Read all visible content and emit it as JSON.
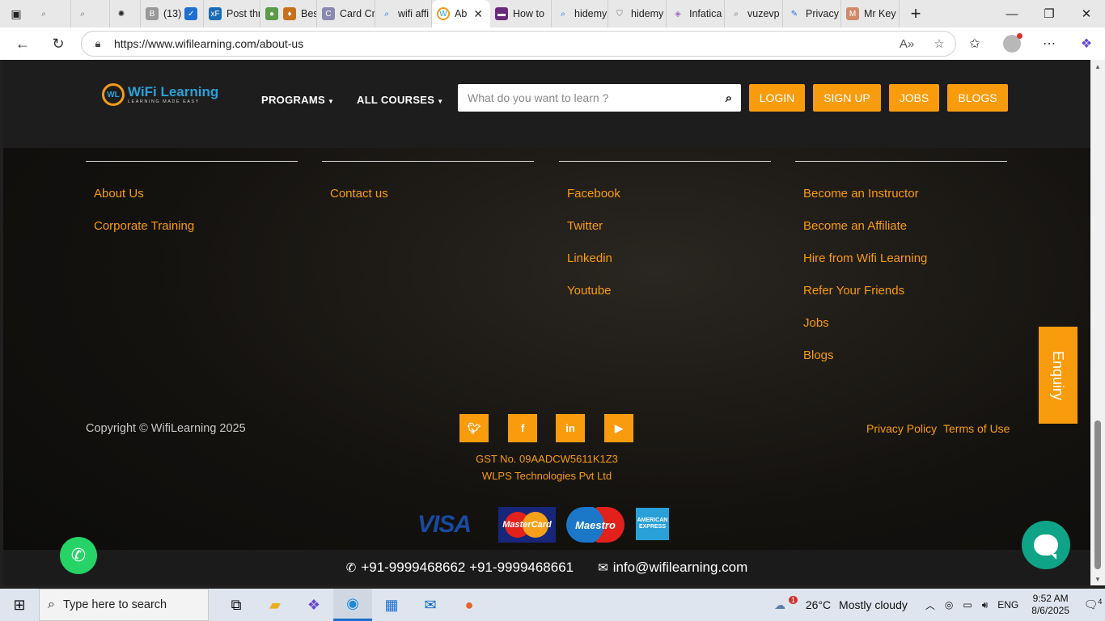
{
  "browser": {
    "tabs": [
      {
        "label": "",
        "icon": "magnifier-icon"
      },
      {
        "label": "",
        "icon": "magnifier-icon"
      },
      {
        "label": "",
        "icon": "chatgpt-icon"
      },
      {
        "label": "(13)",
        "icon": "bookmark-icon"
      },
      {
        "label": "Post thr",
        "icon": "xf-icon"
      },
      {
        "label": "Bes",
        "icon": "globe-icon"
      },
      {
        "label": "Card Cr",
        "icon": "card-icon"
      },
      {
        "label": "wifi affi",
        "icon": "magnifier-icon"
      },
      {
        "label": "Ab",
        "icon": "wifilearning-icon",
        "active": true
      },
      {
        "label": "How to",
        "icon": "site-icon"
      },
      {
        "label": "hidemy",
        "icon": "magnifier-icon"
      },
      {
        "label": "hidemy",
        "icon": "shield-icon"
      },
      {
        "label": "Infatica",
        "icon": "infatica-icon"
      },
      {
        "label": "vuzevp",
        "icon": "magnifier-icon"
      },
      {
        "label": "Privacy",
        "icon": "privacy-icon"
      },
      {
        "label": "Mr Key",
        "icon": "mrkey-icon"
      }
    ],
    "url": "https://www.wifilearning.com/about-us"
  },
  "header": {
    "logo_main": "WiFi Learning",
    "logo_tag": "LEARNING MADE EASY",
    "nav": {
      "programs": "PROGRAMS",
      "all_courses": "ALL COURSES"
    },
    "search_placeholder": "What do you want to learn ?",
    "buttons": {
      "login": "LOGIN",
      "signup": "SIGN UP",
      "jobs": "JOBS",
      "blogs": "BLOGS"
    }
  },
  "footer": {
    "col1": [
      "About Us",
      "Corporate Training"
    ],
    "col2": [
      "Contact us"
    ],
    "col3": [
      "Facebook",
      "Twitter",
      "Linkedin",
      "Youtube"
    ],
    "col4": [
      "Become an Instructor",
      "Become an Affiliate",
      "Hire from Wifi Learning",
      "Refer Your Friends",
      "Jobs",
      "Blogs"
    ],
    "copyright": "Copyright © WifiLearning 2025",
    "privacy": "Privacy Policy",
    "terms": "Terms of Use",
    "gst": "GST No. 09AADCW5611K1Z3",
    "company": "WLPS Technologies Pvt Ltd",
    "payments": {
      "visa": "VISA",
      "mastercard": "MasterCard",
      "maestro": "Maestro",
      "amex": "AMERICAN EXPRESS"
    },
    "phone": "+91-9999468662 +91-9999468661",
    "email": "info@wifilearning.com"
  },
  "widgets": {
    "enquiry": "Enquiry"
  },
  "taskbar": {
    "search_placeholder": "Type here to search",
    "temperature": "26°C",
    "weather": "Mostly cloudy",
    "weather_badge": "1",
    "language": "ENG",
    "time": "9:52 AM",
    "date": "8/6/2025",
    "notifications": "4"
  },
  "colors": {
    "accent": "#f89c0e",
    "header_bg": "#1d1d1d",
    "whatsapp": "#25d366",
    "chat": "#0fa387"
  }
}
